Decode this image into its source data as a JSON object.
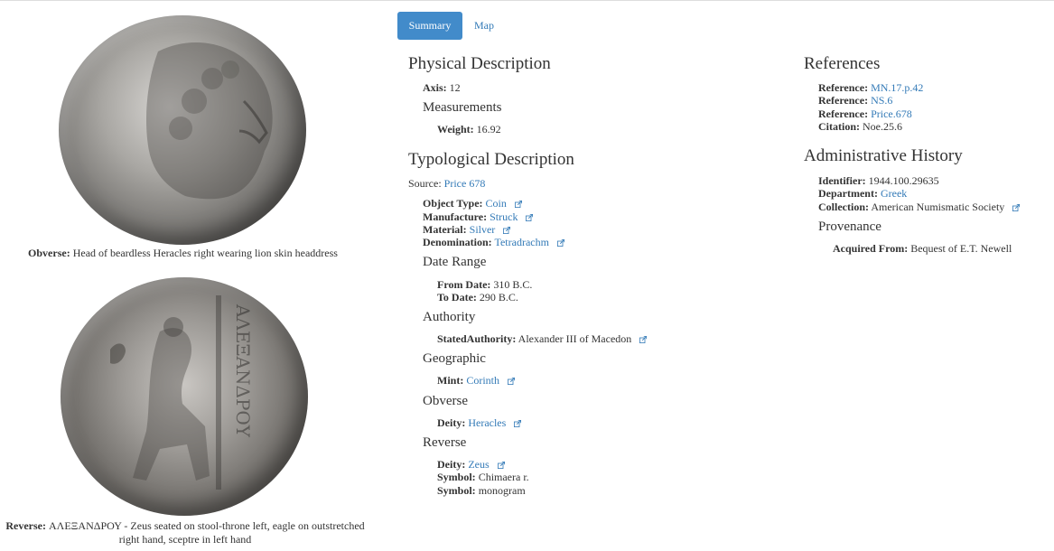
{
  "tabs": {
    "summary": "Summary",
    "map": "Map"
  },
  "images": {
    "obverse_caption_label": "Obverse:",
    "obverse_caption_text": "Head of beardless Heracles right wearing lion skin headdress",
    "reverse_caption_label": "Reverse:",
    "reverse_caption_text1": "ΑΛΕΞΑΝΔΡΟΥ - Zeus seated on stool-throne left, eagle on outstretched",
    "reverse_caption_text2": "right hand, sceptre in left hand",
    "reverse_legend": "ΑΛΕΞΑΝΔΡΟΥ"
  },
  "physical": {
    "title": "Physical Description",
    "axis_label": "Axis:",
    "axis_value": "12",
    "measurements_title": "Measurements",
    "weight_label": "Weight:",
    "weight_value": "16.92"
  },
  "typological": {
    "title": "Typological Description",
    "source_label": "Source:",
    "source_value": "Price 678",
    "object_type_label": "Object Type:",
    "object_type_value": "Coin",
    "manufacture_label": "Manufacture:",
    "manufacture_value": "Struck",
    "material_label": "Material:",
    "material_value": "Silver",
    "denomination_label": "Denomination:",
    "denomination_value": "Tetradrachm",
    "date_range_title": "Date Range",
    "from_label": "From Date:",
    "from_value": "310 B.C.",
    "to_label": "To Date:",
    "to_value": "290 B.C.",
    "authority_title": "Authority",
    "stated_label": "StatedAuthority:",
    "stated_value": "Alexander III of Macedon",
    "geographic_title": "Geographic",
    "mint_label": "Mint:",
    "mint_value": "Corinth",
    "obverse_title": "Obverse",
    "obv_deity_label": "Deity:",
    "obv_deity_value": "Heracles",
    "reverse_title": "Reverse",
    "rev_deity_label": "Deity:",
    "rev_deity_value": "Zeus",
    "symbol1_label": "Symbol:",
    "symbol1_value": "Chimaera r.",
    "symbol2_label": "Symbol:",
    "symbol2_value": "monogram"
  },
  "references": {
    "title": "References",
    "items": [
      {
        "label": "Reference:",
        "value": "MN.17.p.42"
      },
      {
        "label": "Reference:",
        "value": "NS.6"
      },
      {
        "label": "Reference:",
        "value": "Price.678"
      }
    ],
    "citation_label": "Citation:",
    "citation_value": "Noe.25.6"
  },
  "admin": {
    "title": "Administrative History",
    "identifier_label": "Identifier:",
    "identifier_value": "1944.100.29635",
    "department_label": "Department:",
    "department_value": "Greek",
    "collection_label": "Collection:",
    "collection_value": "American Numismatic Society",
    "provenance_title": "Provenance",
    "acquired_label": "Acquired From:",
    "acquired_value": "Bequest of E.T. Newell"
  },
  "colors": {
    "accent": "#428bca",
    "link": "#337ab7",
    "text": "#333333"
  }
}
